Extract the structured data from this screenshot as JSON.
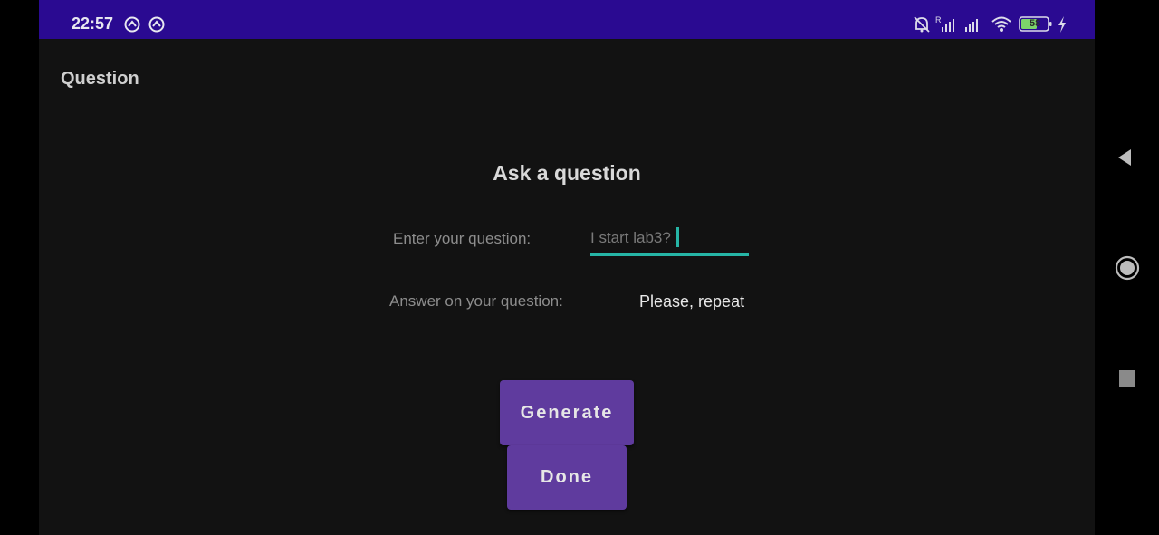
{
  "status_bar": {
    "time": "22:57",
    "battery_level": "58",
    "left_icons": [
      "sync-icon",
      "sync-icon"
    ],
    "right_icons": [
      "bell-off-icon",
      "signal-icon",
      "signal-icon",
      "wifi-icon",
      "battery-icon",
      "charging-icon"
    ],
    "background_color": "#2a0a91"
  },
  "app_bar": {
    "title": "Question"
  },
  "main": {
    "heading": "Ask a question",
    "question_label": "Enter your question:",
    "question_value": "I start lab3?",
    "answer_label": "Answer on your question:",
    "answer_value": "Please, repeat",
    "generate_label": "Generate",
    "done_label": "Done",
    "accent_color": "#26b5a6",
    "button_color": "#5f3b9e"
  },
  "nav_bar": {
    "buttons": [
      "back-icon",
      "home-icon",
      "recents-icon"
    ]
  }
}
